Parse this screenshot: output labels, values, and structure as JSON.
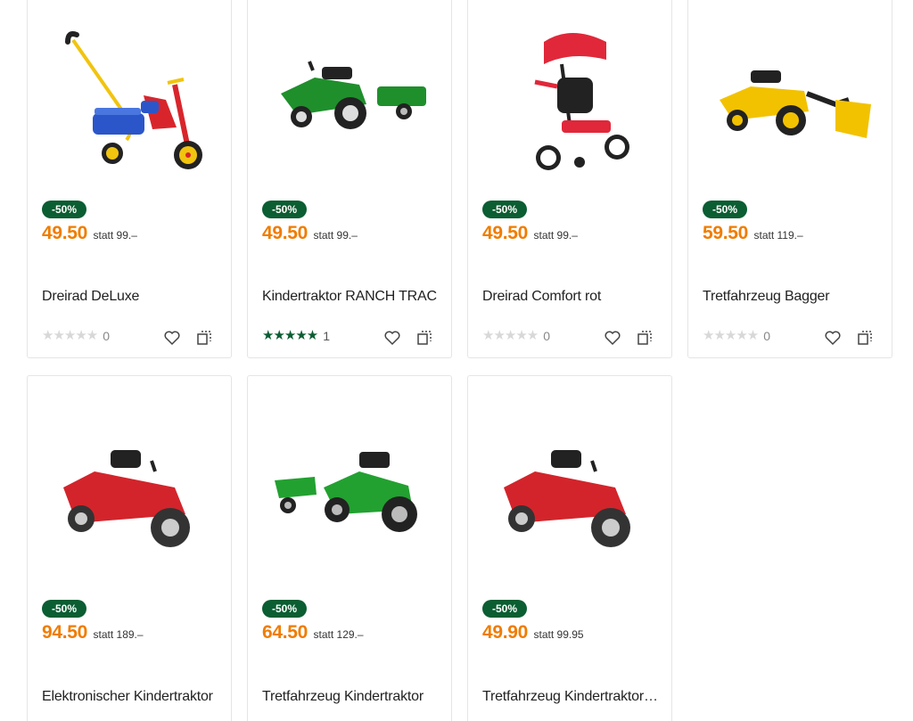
{
  "products": [
    {
      "badge": "-50%",
      "price": "49.50",
      "statt": "statt 99.–",
      "title": "Dreirad DeLuxe",
      "rating_count": "0",
      "rated": false,
      "image": "tricycle-yellow-red-blue"
    },
    {
      "badge": "-50%",
      "price": "49.50",
      "statt": "statt 99.–",
      "title": "Kindertraktor RANCH TRAC",
      "rating_count": "1",
      "rated": true,
      "image": "green-tractor-with-trailer"
    },
    {
      "badge": "-50%",
      "price": "49.50",
      "statt": "statt 99.–",
      "title": "Dreirad Comfort rot",
      "rating_count": "0",
      "rated": false,
      "image": "red-tricycle-canopy"
    },
    {
      "badge": "-50%",
      "price": "59.50",
      "statt": "statt 119.–",
      "title": "Tretfahrzeug Bagger",
      "rating_count": "0",
      "rated": false,
      "image": "yellow-excavator"
    },
    {
      "badge": "-50%",
      "price": "94.50",
      "statt": "statt 189.–",
      "title": "Elektronischer Kindertraktor",
      "rating_count": "",
      "rated": false,
      "image": "red-tractor"
    },
    {
      "badge": "-50%",
      "price": "64.50",
      "statt": "statt 129.–",
      "title": "Tretfahrzeug Kindertraktor",
      "rating_count": "",
      "rated": false,
      "image": "green-tractor-trailer-front"
    },
    {
      "badge": "-50%",
      "price": "49.90",
      "statt": "statt 99.95",
      "title": "Tretfahrzeug Kindertraktor rot",
      "rating_count": "",
      "rated": false,
      "image": "red-tractor"
    }
  ],
  "colors": {
    "accent_price": "#f07c00",
    "badge_bg": "#0b5d32",
    "star_full": "#0b5d32",
    "star_empty": "#d8d8d8"
  },
  "icons": {
    "wishlist": "heart-icon",
    "compare": "compare-icon",
    "rating": "star-icon"
  }
}
